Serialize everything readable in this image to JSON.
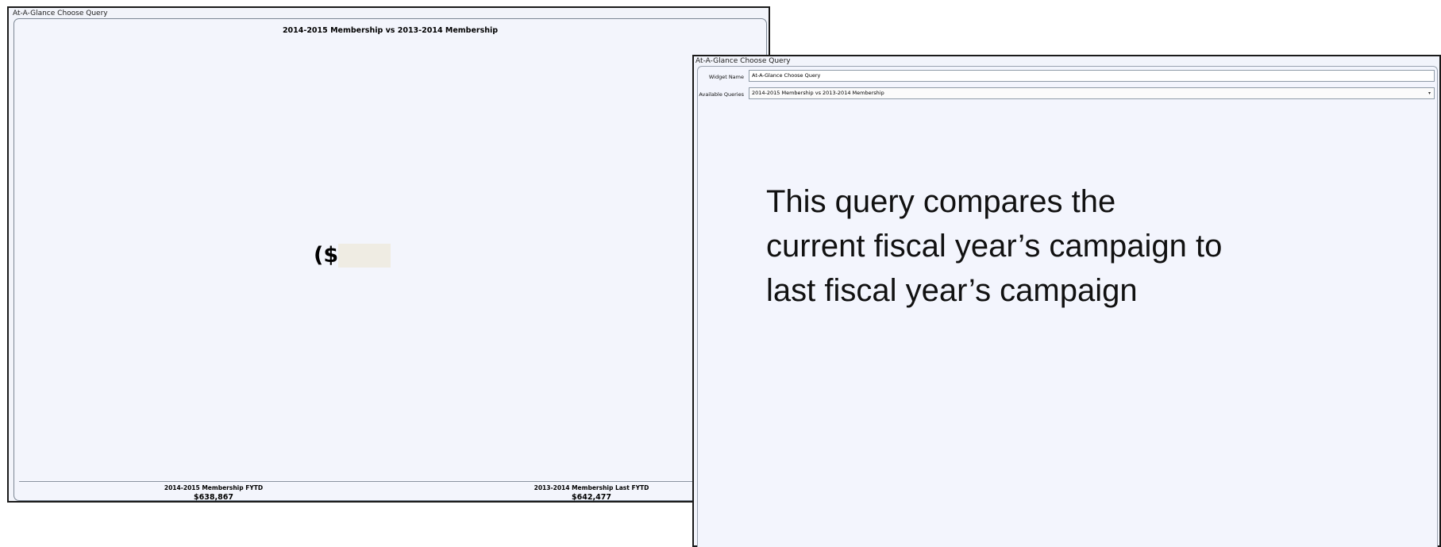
{
  "left_window": {
    "title": "At-A-Glance Choose Query",
    "heading": "2014-2015 Membership vs 2013-2014 Membership",
    "big_value_prefix": "($",
    "big_value_suffix": ")",
    "stats": [
      {
        "label": "2014-2015 Membership FYTD",
        "value": "$638,867"
      },
      {
        "label": "2013-2014 Membership Last FYTD",
        "value": "$642,477"
      }
    ]
  },
  "right_window": {
    "title": "At-A-Glance Choose Query",
    "widget_name_label": "Widget Name",
    "widget_name_value": "At-A-Glance Choose Query",
    "available_queries_label": "Available Queries",
    "available_queries_value": "2014-2015 Membership vs 2013-2014 Membership",
    "dropdown_icon": "chevron-down-icon",
    "description_lines": [
      "This query compares the",
      "current fiscal year’s campaign to",
      "last fiscal year’s campaign"
    ]
  }
}
